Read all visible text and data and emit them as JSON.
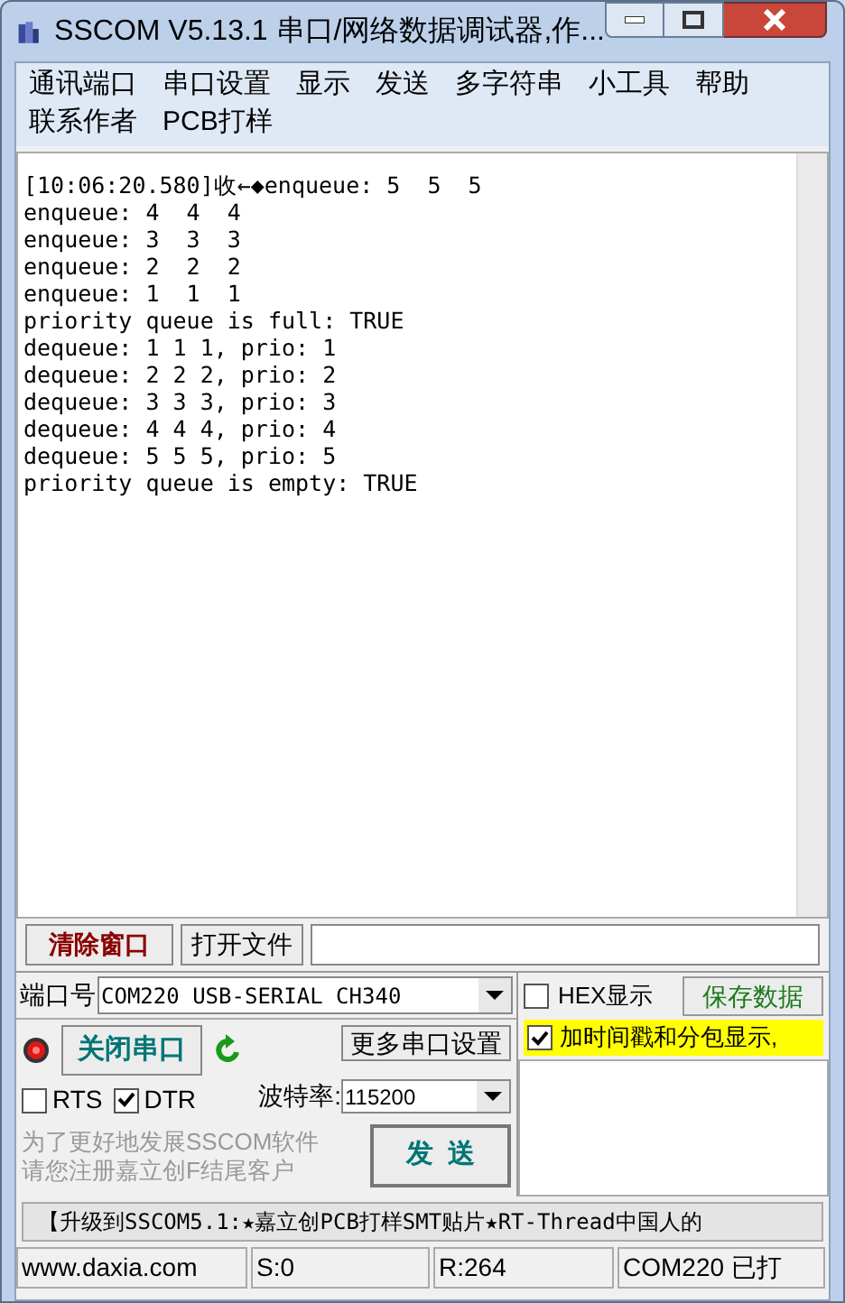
{
  "window": {
    "title": "SSCOM V5.13.1 串口/网络数据调试器,作..."
  },
  "menu": [
    [
      "通讯端口",
      "串口设置",
      "显示",
      "发送",
      "多字符串",
      "小工具",
      "帮助"
    ],
    [
      "联系作者",
      "PCB打样"
    ]
  ],
  "terminal": {
    "lines": [
      "[10:06:20.580]收←◆enqueue: 5  5  5",
      "enqueue: 4  4  4",
      "enqueue: 3  3  3",
      "enqueue: 2  2  2",
      "enqueue: 1  1  1",
      "priority queue is full: TRUE",
      "dequeue: 1 1 1, prio: 1",
      "dequeue: 2 2 2, prio: 2",
      "dequeue: 3 3 3, prio: 3",
      "dequeue: 4 4 4, prio: 4",
      "dequeue: 5 5 5, prio: 5",
      "priority queue is empty: TRUE"
    ]
  },
  "clear_button": "清除窗口",
  "open_file_button": "打开文件",
  "port": {
    "label": "端口号",
    "value": "COM220 USB-SERIAL CH340"
  },
  "hex_display": {
    "label": "HEX显示",
    "checked": false
  },
  "save_button": "保存数据",
  "timestamp": {
    "label": "加时间戳和分包显示,",
    "checked": true
  },
  "close_port_button": "关闭串口",
  "more_settings_button": "更多串口设置",
  "rts": {
    "label": "RTS",
    "checked": false
  },
  "dtr": {
    "label": "DTR",
    "checked": true
  },
  "baud": {
    "label": "波特率:",
    "value": "115200"
  },
  "promo": [
    "为了更好地发展SSCOM软件",
    "请您注册嘉立创F结尾客户"
  ],
  "send_button": "发  送",
  "marquee": "【升级到SSCOM5.1:★嘉立创PCB打样SMT贴片★RT-Thread中国人的",
  "status_bar": [
    "www.daxia.com",
    "S:0",
    "R:264",
    "COM220 已打"
  ]
}
